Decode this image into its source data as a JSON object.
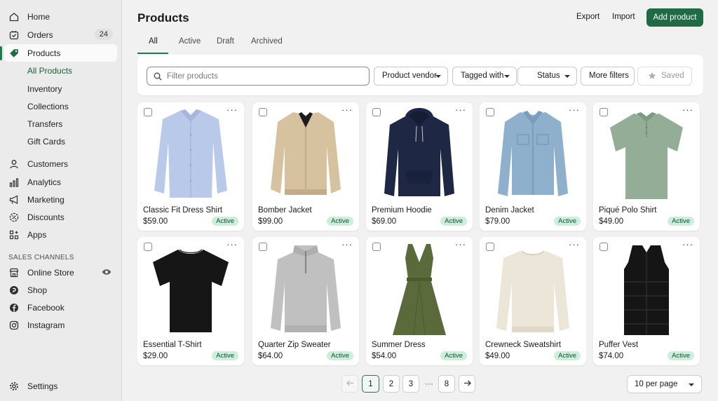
{
  "sidebar": {
    "items": [
      {
        "label": "Home",
        "icon": "home-icon"
      },
      {
        "label": "Orders",
        "icon": "orders-icon",
        "count": "24"
      },
      {
        "label": "Products",
        "icon": "tag-icon"
      },
      {
        "label": "All Products"
      },
      {
        "label": "Inventory"
      },
      {
        "label": "Collections"
      },
      {
        "label": "Transfers"
      },
      {
        "label": "Gift Cards"
      },
      {
        "label": "Customers",
        "icon": "person-icon"
      },
      {
        "label": "Analytics",
        "icon": "bar-chart-icon"
      },
      {
        "label": "Marketing",
        "icon": "megaphone-icon"
      },
      {
        "label": "Discounts",
        "icon": "discount-icon"
      },
      {
        "label": "Apps",
        "icon": "apps-grid-icon"
      }
    ],
    "sales_channels_heading": "SALES CHANNELS",
    "channels": [
      {
        "label": "Online Store",
        "icon": "store-icon"
      },
      {
        "label": "Shop",
        "icon": "shop-icon"
      },
      {
        "label": "Facebook",
        "icon": "facebook-icon"
      },
      {
        "label": "Instagram",
        "icon": "instagram-icon"
      }
    ],
    "settings_label": "Settings"
  },
  "header": {
    "title": "Products",
    "export_label": "Export",
    "import_label": "Import",
    "add_label": "Add product"
  },
  "tabs": [
    "All",
    "Active",
    "Draft",
    "Archived"
  ],
  "filters": {
    "search_placeholder": "Filter products",
    "vendor_label": "Product vendor",
    "tagged_label": "Tagged with",
    "status_label": "Status",
    "more_label": "More filters",
    "saved_label": "Saved"
  },
  "products": [
    {
      "name": "Classic Fit Dress Shirt",
      "price": "$59.00",
      "status": "Active",
      "image": "dress-shirt",
      "color": "#b9c9ea"
    },
    {
      "name": "Bomber Jacket",
      "price": "$99.00",
      "status": "Active",
      "image": "bomber-jacket",
      "color": "#d6c29f"
    },
    {
      "name": "Premium Hoodie",
      "price": "$69.00",
      "status": "Active",
      "image": "hoodie",
      "color": "#1e2744"
    },
    {
      "name": "Denim Jacket",
      "price": "$79.00",
      "status": "Active",
      "image": "denim-jacket",
      "color": "#8fb0cc"
    },
    {
      "name": "Piqué Polo Shirt",
      "price": "$49.00",
      "status": "Active",
      "image": "polo-shirt",
      "color": "#93ad96"
    },
    {
      "name": "Essential T-Shirt",
      "price": "$29.00",
      "status": "Active",
      "image": "t-shirt",
      "color": "#161616"
    },
    {
      "name": "Quarter Zip Sweater",
      "price": "$64.00",
      "status": "Active",
      "image": "quarter-zip",
      "color": "#c0c0c0"
    },
    {
      "name": "Summer Dress",
      "price": "$54.00",
      "status": "Active",
      "image": "dress",
      "color": "#5b6a3a"
    },
    {
      "name": "Crewneck Sweatshirt",
      "price": "$49.00",
      "status": "Active",
      "image": "sweatshirt",
      "color": "#ece6d8"
    },
    {
      "name": "Puffer Vest",
      "price": "$74.00",
      "status": "Active",
      "image": "puffer-vest",
      "color": "#151515"
    }
  ],
  "pagination": {
    "pages": [
      "1",
      "2",
      "3",
      "8"
    ],
    "current": "1",
    "ellipsis": "···",
    "per_page": "10 per page"
  },
  "colors": {
    "accent": "#1e6b45",
    "active_badge_bg": "#cdeedb",
    "active_badge_text": "#0c5132"
  }
}
